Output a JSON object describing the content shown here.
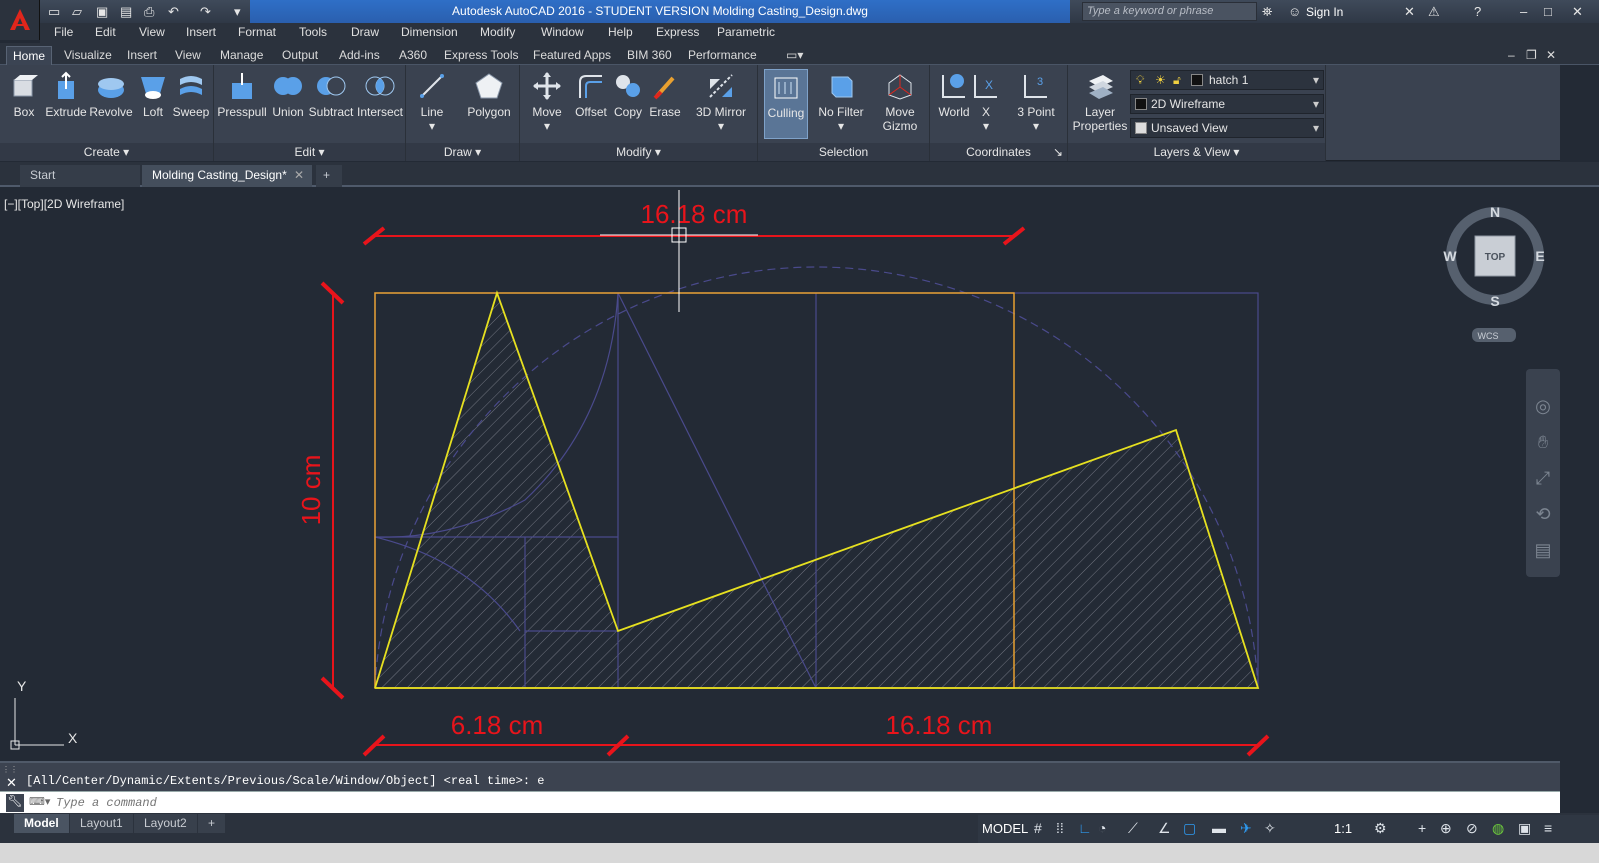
{
  "app": {
    "title": "Autodesk AutoCAD 2016 - STUDENT VERSION    Molding Casting_Design.dwg",
    "search_placeholder": "Type a keyword or phrase",
    "sign_in": "Sign In"
  },
  "menu": [
    "File",
    "Edit",
    "View",
    "Insert",
    "Format",
    "Tools",
    "Draw",
    "Dimension",
    "Modify",
    "Window",
    "Help",
    "Express",
    "Parametric"
  ],
  "ribbon_tabs": [
    "Home",
    "Visualize",
    "Insert",
    "View",
    "Manage",
    "Output",
    "Add-ins",
    "A360",
    "Express Tools",
    "Featured Apps",
    "BIM 360",
    "Performance"
  ],
  "ribbon": {
    "create": {
      "title": "Create",
      "tools": [
        "Box",
        "Extrude",
        "Revolve",
        "Loft",
        "Sweep"
      ]
    },
    "edit": {
      "title": "Edit",
      "tools": [
        "Presspull",
        "Union",
        "Subtract",
        "Intersect"
      ]
    },
    "draw": {
      "title": "Draw",
      "tools": [
        "Line",
        "Polygon"
      ]
    },
    "modify": {
      "title": "Modify",
      "tools": [
        "Move",
        "Offset",
        "Copy",
        "Erase",
        "3D Mirror"
      ]
    },
    "selection": {
      "title": "Selection",
      "tools": [
        "Culling",
        "No Filter",
        "Move Gizmo"
      ]
    },
    "coordinates": {
      "title": "Coordinates",
      "tools": [
        "World",
        "X",
        "3 Point"
      ]
    },
    "layers": {
      "title": "Layers & View",
      "tool": "Layer Properties",
      "layer": "hatch 1",
      "visual_style": "2D Wireframe",
      "view": "Unsaved View"
    }
  },
  "doc_tabs": [
    "Start",
    "Molding Casting_Design*"
  ],
  "viewport_label": "[−][Top][2D Wireframe]",
  "viewcube": {
    "n": "N",
    "s": "S",
    "e": "E",
    "w": "W",
    "face": "TOP",
    "wcs": "WCS"
  },
  "dimensions": {
    "top": "16.18 cm",
    "left": "10 cm",
    "bottom_left": "6.18 cm",
    "bottom_right": "16.18 cm"
  },
  "ucs": {
    "x": "X",
    "y": "Y"
  },
  "command": {
    "history": "[All/Center/Dynamic/Extents/Previous/Scale/Window/Object] <real time>: e",
    "placeholder": "Type a command"
  },
  "layout_tabs": [
    "Model",
    "Layout1",
    "Layout2"
  ],
  "status": {
    "model": "MODEL",
    "scale": "1:1"
  },
  "colors": {
    "dimension": "#e8141b",
    "outline": "#e8a030",
    "profile": "#e6e020",
    "construction": "#4a4a8c"
  }
}
